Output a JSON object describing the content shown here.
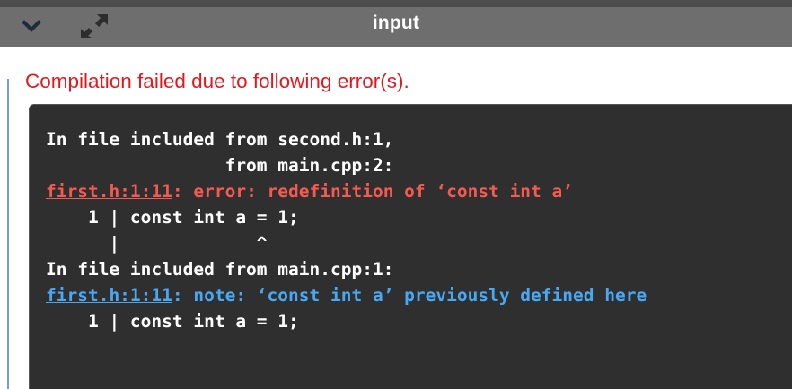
{
  "panel": {
    "title": "input",
    "icons": [
      "chevron-down-icon",
      "expand-icon"
    ]
  },
  "error": {
    "message": "Compilation failed due to following error(s)."
  },
  "console": {
    "lines": [
      {
        "text": "In file included from second.h:1,"
      },
      {
        "text": "                 from main.cpp:2:"
      },
      {
        "link": "first.h:1:11",
        "rest": ": error: redefinition of ‘const int a’"
      },
      {
        "text": "    1 | const int a = 1;"
      },
      {
        "text": "      |             ^"
      },
      {
        "text": "In file included from main.cpp:1:"
      },
      {
        "link": "first.h:1:11",
        "rest": ": note: ‘const int a’ previously defined here"
      },
      {
        "text": "    1 | const int a = 1;"
      }
    ]
  },
  "colors": {
    "error_text": "#e8161b",
    "console_bg": "#2f2f2f",
    "console_error": "#f25a52",
    "console_note": "#4aa7f2",
    "header_bg": "#6e6e6e"
  }
}
